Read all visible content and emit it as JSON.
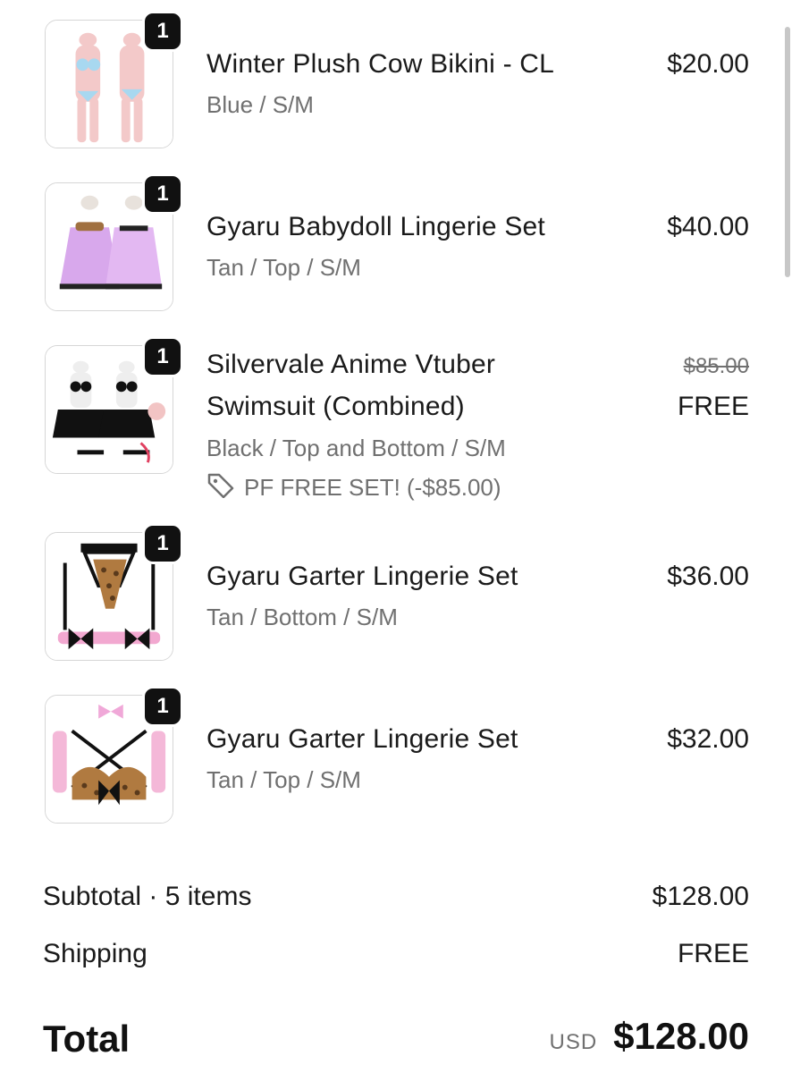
{
  "items": [
    {
      "title_lines": [
        "Winter Plush Cow Bikini - CL"
      ],
      "variant": "Blue / S/M",
      "price": "$20.00",
      "qty": "1"
    },
    {
      "title_lines": [
        "Gyaru Babydoll Lingerie Set"
      ],
      "variant": "Tan / Top / S/M",
      "price": "$40.00",
      "qty": "1"
    },
    {
      "title_lines": [
        "Silvervale Anime Vtuber",
        "Swimsuit (Combined)"
      ],
      "variant": "Black / Top and Bottom / S/M",
      "original_price": "$85.00",
      "price": "FREE",
      "discount": "PF FREE SET! (-$85.00)",
      "qty": "1"
    },
    {
      "title_lines": [
        "Gyaru Garter Lingerie Set"
      ],
      "variant": "Tan / Bottom / S/M",
      "price": "$36.00",
      "qty": "1"
    },
    {
      "title_lines": [
        "Gyaru Garter Lingerie Set"
      ],
      "variant": "Tan / Top / S/M",
      "price": "$32.00",
      "qty": "1"
    }
  ],
  "summary": {
    "subtotal_label": "Subtotal · 5 items",
    "subtotal_value": "$128.00",
    "shipping_label": "Shipping",
    "shipping_value": "FREE",
    "total_label": "Total",
    "currency": "USD",
    "total_value": "$128.00"
  },
  "icons": {
    "discount": "tag-icon"
  }
}
